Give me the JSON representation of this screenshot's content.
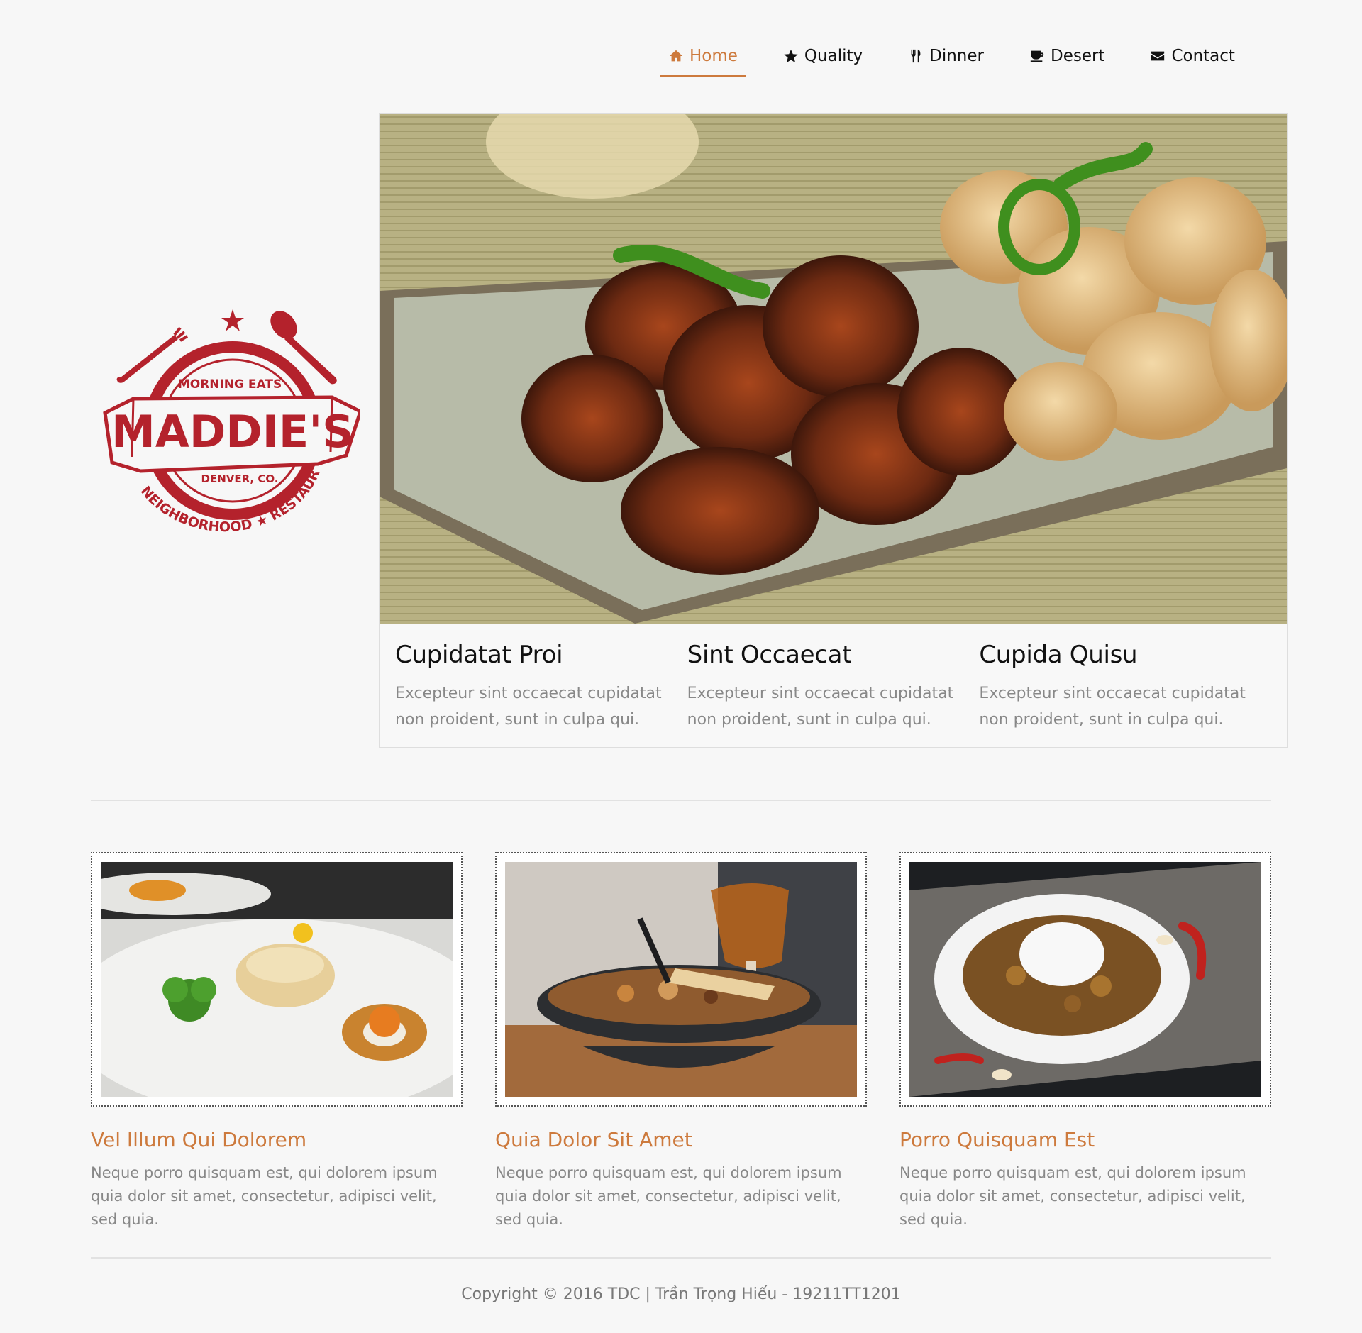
{
  "nav": {
    "items": [
      {
        "label": "Home",
        "icon": "home-icon",
        "active": true
      },
      {
        "label": "Quality",
        "icon": "star-icon"
      },
      {
        "label": "Dinner",
        "icon": "cutlery-icon"
      },
      {
        "label": "Desert",
        "icon": "coffee-icon"
      },
      {
        "label": "Contact",
        "icon": "envelope-icon"
      }
    ]
  },
  "logo": {
    "top_text": "MORNING EATS",
    "name": "MADDIE'S",
    "location": "DENVER, CO.",
    "bottom_text": "NEIGHBORHOOD ★ RESTAURANT",
    "color": "#b4222c"
  },
  "hero": {
    "captions": [
      {
        "title": "Cupidatat Proi",
        "text": "Excepteur sint occaecat cupidatat non proident, sunt in culpa qui."
      },
      {
        "title": "Sint Occaecat",
        "text": "Excepteur sint occaecat cupidatat non proident, sunt in culpa qui."
      },
      {
        "title": "Cupida Quisu",
        "text": "Excepteur sint occaecat cupidatat non proident, sunt in culpa qui."
      }
    ]
  },
  "cards": [
    {
      "title": "Vel Illum Qui Dolorem",
      "text": "Neque porro quisquam est, qui dolorem ipsum quia dolor sit amet, consectetur, adipisci velit, sed quia."
    },
    {
      "title": "Quia Dolor Sit Amet",
      "text": "Neque porro quisquam est, qui dolorem ipsum quia dolor sit amet, consectetur, adipisci velit, sed quia."
    },
    {
      "title": "Porro Quisquam Est",
      "text": "Neque porro quisquam est, qui dolorem ipsum quia dolor sit amet, consectetur, adipisci velit, sed quia."
    }
  ],
  "footer": {
    "text": "Copyright © 2016 TDC | Trần Trọng Hiếu - 19211TT1201"
  },
  "colors": {
    "accent": "#cd7a3d",
    "logo_red": "#b4222c",
    "background": "#f7f7f7"
  }
}
